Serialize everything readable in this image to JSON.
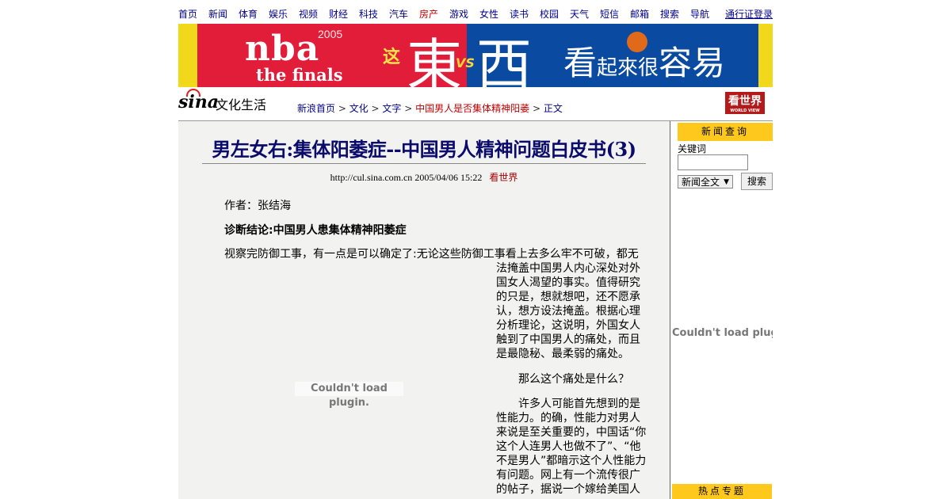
{
  "nav": {
    "items": [
      {
        "label": "首页",
        "hot": false
      },
      {
        "label": "新闻",
        "hot": false
      },
      {
        "label": "体育",
        "hot": false
      },
      {
        "label": "娱乐",
        "hot": false
      },
      {
        "label": "视频",
        "hot": false
      },
      {
        "label": "财经",
        "hot": false
      },
      {
        "label": "科技",
        "hot": false
      },
      {
        "label": "汽车",
        "hot": false
      },
      {
        "label": "房产",
        "hot": true
      },
      {
        "label": "游戏",
        "hot": false
      },
      {
        "label": "女性",
        "hot": false
      },
      {
        "label": "读书",
        "hot": false
      },
      {
        "label": "校园",
        "hot": false
      },
      {
        "label": "天气",
        "hot": false
      },
      {
        "label": "短信",
        "hot": false
      },
      {
        "label": "邮箱",
        "hot": false
      },
      {
        "label": "搜索",
        "hot": false
      },
      {
        "label": "导航",
        "hot": false
      }
    ],
    "login": "通行证登录"
  },
  "banner": {
    "nba": "nba",
    "year": "2005",
    "finals": "the finals",
    "zhe": "这",
    "dong": "東",
    "vs": "VS",
    "xi": "西",
    "slogan_big1": "看",
    "slogan_small1": "起來",
    "slogan_small2": "很",
    "slogan_big2": "容易"
  },
  "channel": {
    "logo": "sina",
    "name": "文化生活",
    "badge": "看世界",
    "badge_sub": "WORLD VIEW"
  },
  "breadcrumb": {
    "items": [
      "新浪首页",
      "文化",
      "文字",
      "中国男人是否集体精神阳萎"
    ],
    "current": "正文",
    "separator": " > "
  },
  "article": {
    "title": "男左女右:集体阳萎症--中国男人精神问题白皮书(3)",
    "url": "http://cul.sina.com.cn",
    "datetime": "2005/04/06 15:22",
    "source": "看世界",
    "author": "作者：张结海",
    "diagnosis": "诊断结论:中国男人患集体精神阳萎症",
    "p1_first": "视察完防御工事，有一点是可以确定了:无论这些防御工事看上去多么牢不可破，都无",
    "p1_rest": "法掩盖中国男人内心深处对外国女人渴望的事实。值得研究的只是，想就想吧，还不愿承认，想方设法掩盖。根据心理分析理论，这说明，外国女人触到了中国男人的痛处，而且是最隐秘、最柔弱的痛处。",
    "p2": "那么这个痛处是什么？",
    "p3": "许多人可能首先想到的是性能力。的确，性能力对男人来说是至关重要的，中国话“你这个人连男人也做不了”、“他不是男人”都暗示这个人性能力有问题。网上有一个流传很广的帖子，据说一个嫁给美国人",
    "plugin_msg": "Couldn't load plugin."
  },
  "sidebar": {
    "news_search_title": "新闻查询",
    "keyword_label": "关键词",
    "keyword_value": "",
    "scope_selected": "新闻全文",
    "search_button": "搜索",
    "plugin_msg": "Couldn't load plugin.",
    "hot_topics_title": "热点专题"
  },
  "colors": {
    "nav_text": "#00008b",
    "hot_red": "#c00000",
    "sidebar_header": "#ffc81c",
    "article_bg": "#f2f3f1",
    "title_color": "#0b0b6b"
  }
}
